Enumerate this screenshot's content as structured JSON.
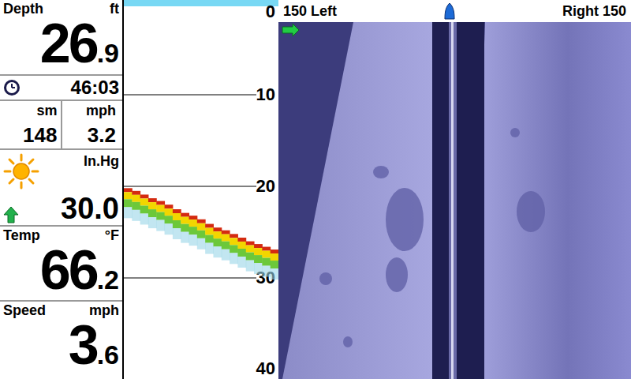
{
  "depth": {
    "label": "Depth",
    "unit": "ft",
    "whole": "26",
    "decimal": ".9"
  },
  "timer": {
    "value": "46:03"
  },
  "trip": {
    "distance_unit": "sm",
    "speed_unit": "mph",
    "distance": "148",
    "speed": "3.2"
  },
  "barometer": {
    "unit": "In.Hg",
    "value": "30.0",
    "rising": true
  },
  "temp": {
    "label": "Temp",
    "unit": "°F",
    "whole": "66",
    "decimal": ".2"
  },
  "speed": {
    "label": "Speed",
    "unit": "mph",
    "whole": "3",
    "decimal": ".6"
  },
  "sonar": {
    "scale": [
      "0",
      "10",
      "20",
      "30",
      "40"
    ],
    "bottom_depth": [
      20.2,
      20.5,
      20.9,
      21.3,
      21.6,
      22.0,
      22.5,
      22.9,
      23.2,
      23.6,
      24.1,
      24.5,
      24.8,
      25.2,
      25.6,
      26.0,
      26.3,
      26.6,
      26.9
    ]
  },
  "side_imaging": {
    "left_label": "150 Left",
    "right_label": "Right 150"
  }
}
